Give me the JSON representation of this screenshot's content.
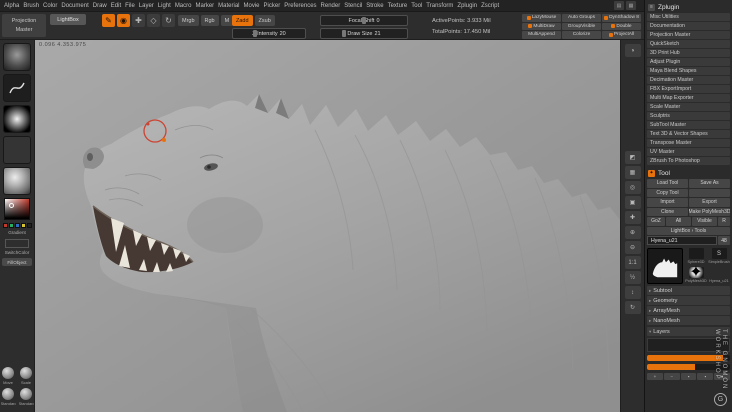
{
  "accent_color": "#e8720c",
  "menubar": {
    "items": [
      "Alpha",
      "Brush",
      "Color",
      "Document",
      "Draw",
      "Edit",
      "File",
      "Layer",
      "Light",
      "Macro",
      "Marker",
      "Material",
      "Movie",
      "Picker",
      "Preferences",
      "Render",
      "Stencil",
      "Stroke",
      "Texture",
      "Tool",
      "Transform",
      "Zplugin",
      "Zscript"
    ]
  },
  "topshelf": {
    "projection_master": "Projection Master",
    "lightbox": "LightBox",
    "mode_buttons": [
      {
        "name": "edit-mode-icon",
        "glyph": "✎",
        "active": true
      },
      {
        "name": "draw-mode-icon",
        "glyph": "◉",
        "active": true
      },
      {
        "name": "move-mode-icon",
        "glyph": "✚",
        "active": false
      },
      {
        "name": "scale-mode-icon",
        "glyph": "◇",
        "active": false
      },
      {
        "name": "rotate-mode-icon",
        "glyph": "↻",
        "active": false
      }
    ],
    "paint_toggles": [
      {
        "label": "Mrgb"
      },
      {
        "label": "Rgb"
      },
      {
        "label": "M"
      }
    ],
    "sculpt_toggles": [
      {
        "label": "Zadd",
        "active": true
      },
      {
        "label": "Zsub",
        "active": false
      }
    ],
    "z_intensity": {
      "label": "Z Intensity",
      "value": "20"
    },
    "focal_shift": {
      "label": "Focal Shift",
      "value": "0"
    },
    "draw_size": {
      "label": "Draw Size",
      "value": "21"
    },
    "active_points": "ActivePoints: 3.933 Mil",
    "total_points": "TotalPoints: 17.450 Mil",
    "right_buttons": [
      {
        "label": "LazyMouse",
        "icon": true
      },
      {
        "label": "Auto Groups",
        "icon": false
      },
      {
        "label": "DynShadow 8",
        "icon": true
      },
      {
        "label": "MultiDraw",
        "icon": true
      },
      {
        "label": "GroupVisible",
        "icon": false
      },
      {
        "label": "Double",
        "icon": true
      },
      {
        "label": "MultiAppend",
        "icon": false
      },
      {
        "label": "Colorize",
        "icon": false
      },
      {
        "label": "ProjectAll",
        "icon": true
      }
    ]
  },
  "left_shelf": {
    "gradient_label": "Gradient",
    "switch_label": "SwitchColor",
    "fill_label": "FillObject",
    "knobs": [
      {
        "label": "Move"
      },
      {
        "label": "Scale"
      },
      {
        "label": "Standard"
      },
      {
        "label": "Standard"
      }
    ]
  },
  "canvas": {
    "stats": "0.096   4.353.975"
  },
  "right_shelf": {
    "icons": [
      {
        "name": "bpr-icon",
        "glyph": "◑"
      },
      {
        "name": "persp-icon",
        "glyph": "◩"
      },
      {
        "name": "floor-icon",
        "glyph": "▦"
      },
      {
        "name": "local-icon",
        "glyph": "◎"
      },
      {
        "name": "frame-icon",
        "glyph": "▣"
      },
      {
        "name": "move-doc-icon",
        "glyph": "✚"
      },
      {
        "name": "zoom-in-icon",
        "glyph": "⊕"
      },
      {
        "name": "zoom-out-icon",
        "glyph": "⊖"
      },
      {
        "name": "actual-size-icon",
        "glyph": "1:1"
      },
      {
        "name": "aa-half-icon",
        "glyph": "½"
      },
      {
        "name": "scroll-doc-icon",
        "glyph": "↕"
      },
      {
        "name": "rotate-doc-icon",
        "glyph": "↻"
      }
    ]
  },
  "zplugin": {
    "title": "Zplugin",
    "items": [
      "Misc Utilities",
      "Documentation",
      "Projection Master",
      "QuickSketch",
      "3D Print Hub",
      "Adjust Plugin",
      "Maya Blend Shapes",
      "Decimation Master",
      "FBX ExportImport",
      "Multi Map Exporter",
      "Scale Master",
      "Sculptris",
      "SubTool Master",
      "Text 3D & Vector Shapes",
      "Transpose Master",
      "UV Master",
      "ZBrush To Photoshop"
    ]
  },
  "tool": {
    "title": "Tool",
    "file_buttons": [
      {
        "label": "Load Tool"
      },
      {
        "label": "Save As"
      },
      {
        "label": "Copy Tool"
      },
      {
        "label": ""
      },
      {
        "label": "Import"
      },
      {
        "label": "Export"
      }
    ],
    "clone_buttons": [
      {
        "label": "Clone"
      },
      {
        "label": "Make PolyMesh3D"
      }
    ],
    "goz_buttons": [
      {
        "label": "GoZ"
      },
      {
        "label": "All"
      },
      {
        "label": "Visible"
      },
      {
        "label": "R"
      }
    ],
    "lightbox_tools": "LightBox › Tools",
    "current_tool": "Hyena_u21",
    "subdiv_badge": "48",
    "thumbnails": [
      {
        "label": "Sphere3D",
        "glyph": ""
      },
      {
        "label": "SimpleBrush",
        "glyph": "S"
      },
      {
        "label": "PolyMesh3D",
        "glyph": "✦"
      },
      {
        "label": "Hyena_u21",
        "glyph": ""
      }
    ],
    "sections": [
      {
        "label": "Subtool"
      },
      {
        "label": "Geometry"
      },
      {
        "label": "ArrayMesh"
      },
      {
        "label": "NanoMesh"
      }
    ],
    "layers_title": "Layers"
  },
  "watermark": {
    "line1": "THE GNOMON",
    "line2": "WORKSHOP",
    "logo": "G"
  }
}
